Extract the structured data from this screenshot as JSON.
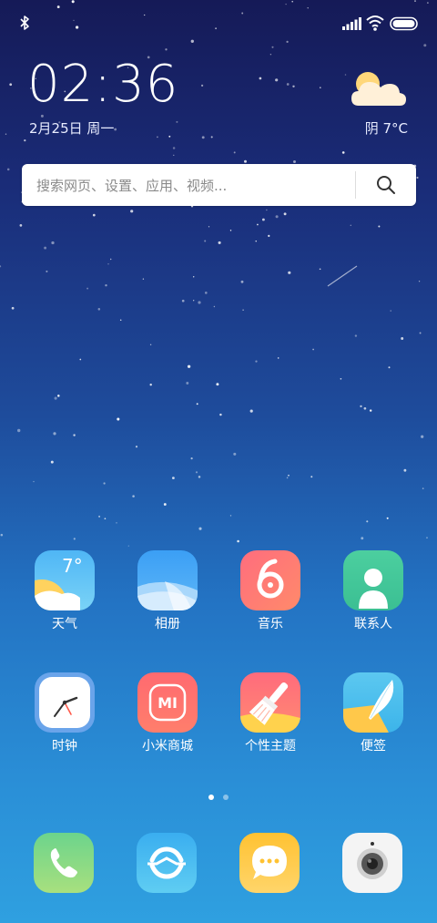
{
  "status_bar": {
    "bluetooth_icon": "bluetooth-icon",
    "signal_icon": "cellular-signal-icon",
    "wifi_icon": "wifi-icon",
    "battery_icon": "battery-icon"
  },
  "clock_widget": {
    "time": "02:36",
    "date": "2月25日 周一",
    "weather_icon": "cloudy-sun-icon",
    "weather": "阴   7°C"
  },
  "search": {
    "placeholder": "搜索网页、设置、应用、视频...",
    "icon": "search-icon"
  },
  "apps": [
    {
      "label": "天气",
      "icon": "weather-app-icon",
      "badge": "7°"
    },
    {
      "label": "相册",
      "icon": "gallery-app-icon"
    },
    {
      "label": "音乐",
      "icon": "music-app-icon"
    },
    {
      "label": "联系人",
      "icon": "contacts-app-icon"
    },
    {
      "label": "时钟",
      "icon": "clock-app-icon"
    },
    {
      "label": "小米商城",
      "icon": "mi-store-app-icon",
      "logo_text": "MI"
    },
    {
      "label": "个性主题",
      "icon": "themes-app-icon"
    },
    {
      "label": "便签",
      "icon": "notes-app-icon"
    }
  ],
  "page_indicator": {
    "current": 1,
    "total": 2
  },
  "dock": [
    {
      "icon": "phone-app-icon"
    },
    {
      "icon": "browser-app-icon"
    },
    {
      "icon": "messages-app-icon"
    },
    {
      "icon": "camera-app-icon"
    }
  ],
  "colors": {
    "wallpaper_top": "#151a57",
    "wallpaper_bottom": "#2fa0e0"
  }
}
